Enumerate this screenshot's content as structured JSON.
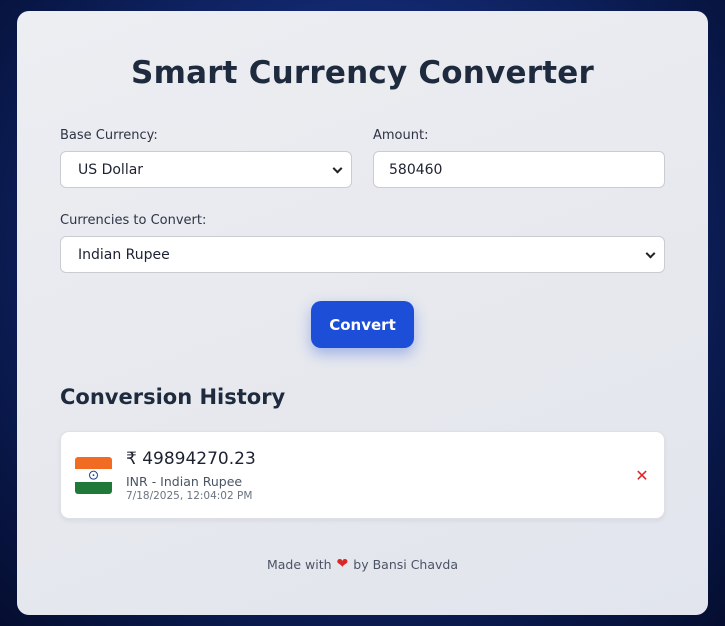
{
  "app": {
    "title": "Smart Currency Converter"
  },
  "form": {
    "base_currency_label": "Base Currency:",
    "base_currency_value": "US Dollar",
    "amount_label": "Amount:",
    "amount_value": "580460",
    "targets_label": "Currencies to Convert:",
    "targets_value": "Indian Rupee",
    "convert_label": "Convert"
  },
  "history": {
    "title": "Conversion History",
    "items": [
      {
        "amount": "₹ 49894270.23",
        "currency": "INR - Indian Rupee",
        "timestamp": "7/18/2025, 12:04:02 PM",
        "flag_icon": "india-flag-icon",
        "delete_icon": "close-icon"
      }
    ]
  },
  "footer": {
    "prefix": "Made with",
    "heart_icon": "heart-icon",
    "suffix": "by Bansi Chavda"
  },
  "colors": {
    "accent": "#1d4ed8",
    "delete": "#dc2626",
    "heart": "#dc2626"
  }
}
